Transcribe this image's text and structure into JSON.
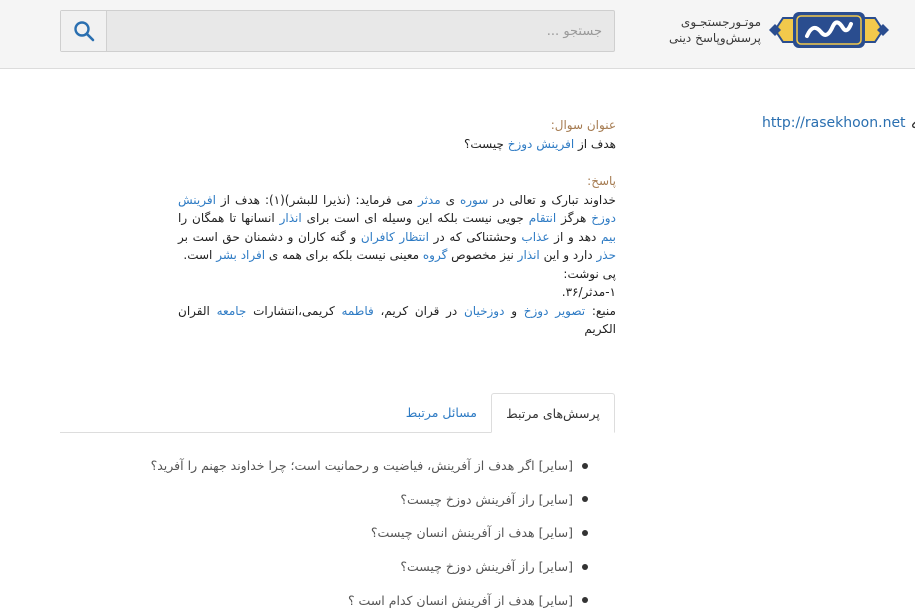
{
  "header": {
    "tagline_line1": "موتـور‌جستجـوی",
    "tagline_line2": "پرسش‌وپاسخ دینی",
    "logo_text": "اسلام‌کوئست",
    "search_placeholder": "جستجو ...",
    "search_value": ""
  },
  "site_link": "http://rasekhoon.net",
  "question": {
    "label": "عنوان سوال:",
    "text_prefix": "هدف از",
    "link": "افرینش دوزخ",
    "text_suffix": "چیست؟"
  },
  "answer": {
    "label": "پاسخ:",
    "p1": "خداوند تبارک و تعالی در",
    "l1": "سوره",
    "p2": "ی",
    "l2": "مدثر",
    "p3": "می فرماید: (نذیرا للبشر)(۱): هدف از",
    "l3": "افرینش دوزخ",
    "p4": "هرگز",
    "l4": "انتقام",
    "p5": "جویی نیست بلکه این وسیله ای است برای",
    "l5": "انذار",
    "p6": "انسانها تا همگان را",
    "l6": "بیم",
    "p7": "دهد و از",
    "l7": "عذاب",
    "p8": "وحشتناکی که در",
    "l8": "انتظار کافران",
    "p9": "و گنه کاران و دشمنان حق است بر",
    "l9": "حذر",
    "p10": "دارد و این",
    "l10": "انذار",
    "p11": "نیز مخصوص",
    "l11": "گروه",
    "p12": "معینی نیست بلکه برای همه ی",
    "l12": "افراد بشر",
    "p13": "است.",
    "footnote_label": "پی نوشت:",
    "footnote": "۱-مدثر/۳۶.",
    "source_prefix": "منبع:",
    "s1": "تصویر دوزخ",
    "s2": "و",
    "s3": "دوزخیان",
    "s4": "در قران کریم،",
    "s5": "فاطمه",
    "s6": "کریمی،انتشارات",
    "s7": "جامعه",
    "s8": "القران الکریم"
  },
  "tabs": {
    "active": "پرسش‌های مرتبط",
    "inactive": "مسائل مرتبط"
  },
  "related": [
    "[سایر] اگر هدف از آفرینش، فیاضیت و رحمانیت است؛ چرا خداوند جهنم را آفرید؟",
    "[سایر] راز آفرینش دوزخ چیست؟",
    "[سایر] هدف از آفرینش انسان چیست؟",
    "[سایر] راز آفرینش دوزخ چیست؟",
    "[سایر] هدف از آفرینش انسان کدام است ؟"
  ]
}
